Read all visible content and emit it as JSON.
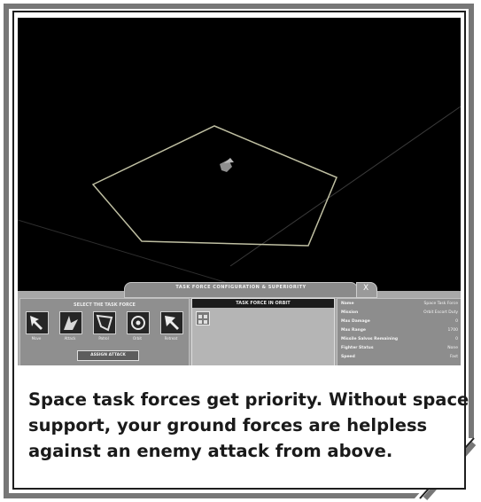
{
  "hud": {
    "title": "TASK FORCE CONFIGURATION & SUPERIORITY",
    "close_glyph": "X",
    "command_panel": {
      "title": "SELECT THE TASK FORCE",
      "commands": [
        {
          "label": "Move",
          "icon": "move-icon"
        },
        {
          "label": "Attack",
          "icon": "attack-icon"
        },
        {
          "label": "Patrol",
          "icon": "patrol-icon"
        },
        {
          "label": "Orbit",
          "icon": "orbit-icon"
        },
        {
          "label": "Retreat",
          "icon": "retreat-icon"
        }
      ],
      "attack_button": "ASSIGN ATTACK"
    },
    "units_panel": {
      "title": "TASK FORCE IN ORBIT"
    },
    "stats": [
      {
        "key": "Name",
        "value": "Space Task Force"
      },
      {
        "key": "Mission",
        "value": "Orbit Escort Duty"
      },
      {
        "key": "Max Damage",
        "value": "0"
      },
      {
        "key": "Max Range",
        "value": "1700"
      },
      {
        "key": "Missile Salvos Remaining",
        "value": "0"
      },
      {
        "key": "Fighter Status",
        "value": "None"
      },
      {
        "key": "Speed",
        "value": "Fast"
      }
    ]
  },
  "caption": {
    "line1": "Space task forces get priority. Without space",
    "line2": "support, your ground forces are helpless",
    "line3": "against an enemy attack from above."
  },
  "colors": {
    "frame": "#777777",
    "scene_bg": "#000000",
    "hud_gray": "#a8a8a8",
    "caption_text": "#1a1a1a"
  }
}
